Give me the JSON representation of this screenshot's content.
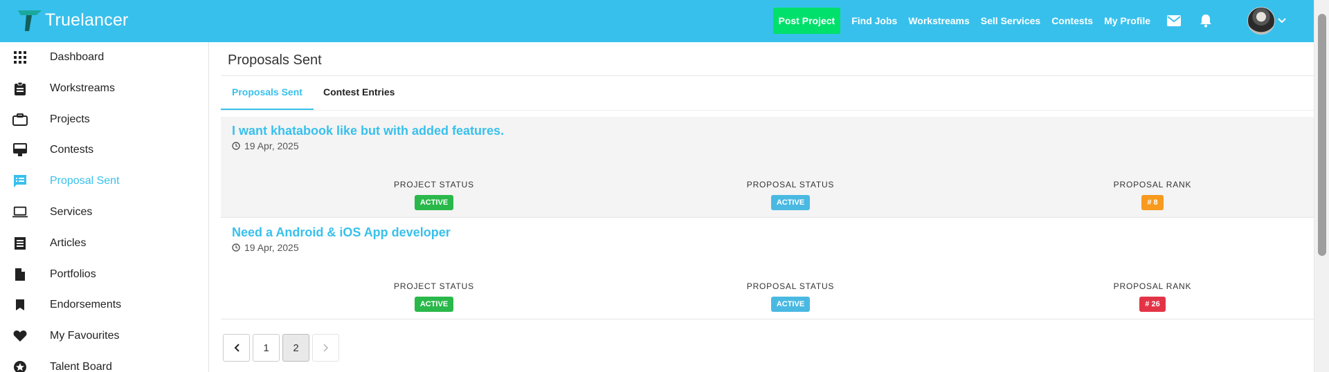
{
  "brand": {
    "name": "Truelancer"
  },
  "topnav": {
    "post_project": "Post Project",
    "links": [
      "Find Jobs",
      "Workstreams",
      "Sell Services",
      "Contests",
      "My Profile"
    ],
    "icons": [
      "mail-icon",
      "bell-icon"
    ]
  },
  "colors": {
    "accent": "#38c0ec",
    "post_green": "#00e06b",
    "badge_green": "#2ab84a",
    "badge_blue": "#4ab9e2",
    "badge_orange": "#f79a1e",
    "badge_red": "#e33447"
  },
  "sidebar": {
    "items": [
      {
        "label": "Dashboard",
        "icon": "grid-icon"
      },
      {
        "label": "Workstreams",
        "icon": "clipboard-icon"
      },
      {
        "label": "Projects",
        "icon": "briefcase-icon"
      },
      {
        "label": "Contests",
        "icon": "card-icon"
      },
      {
        "label": "Proposal Sent",
        "icon": "message-icon"
      },
      {
        "label": "Services",
        "icon": "laptop-icon"
      },
      {
        "label": "Articles",
        "icon": "article-icon"
      },
      {
        "label": "Portfolios",
        "icon": "file-icon"
      },
      {
        "label": "Endorsements",
        "icon": "bookmark-icon"
      },
      {
        "label": "My Favourites",
        "icon": "heart-icon"
      },
      {
        "label": "Talent Board",
        "icon": "star-icon"
      }
    ],
    "active": "Proposal Sent"
  },
  "main": {
    "title": "Proposals Sent",
    "tabs": [
      {
        "label": "Proposals Sent"
      },
      {
        "label": "Contest Entries"
      }
    ],
    "proposals": [
      {
        "title": "I want khatabook like but with added features.",
        "date": "19 Apr, 2025",
        "project_status_label": "PROJECT STATUS",
        "project_status": "ACTIVE",
        "proposal_status_label": "PROPOSAL STATUS",
        "proposal_status": "ACTIVE",
        "proposal_rank_label": "PROPOSAL RANK",
        "proposal_rank": "# 8"
      },
      {
        "title": "Need a Android & iOS App developer",
        "date": "19 Apr, 2025",
        "project_status_label": "PROJECT STATUS",
        "project_status": "ACTIVE",
        "proposal_status_label": "PROPOSAL STATUS",
        "proposal_status": "ACTIVE",
        "proposal_rank_label": "PROPOSAL RANK",
        "proposal_rank": "# 26"
      }
    ],
    "pagination": {
      "pages": [
        "1",
        "2"
      ],
      "current": "2"
    }
  }
}
